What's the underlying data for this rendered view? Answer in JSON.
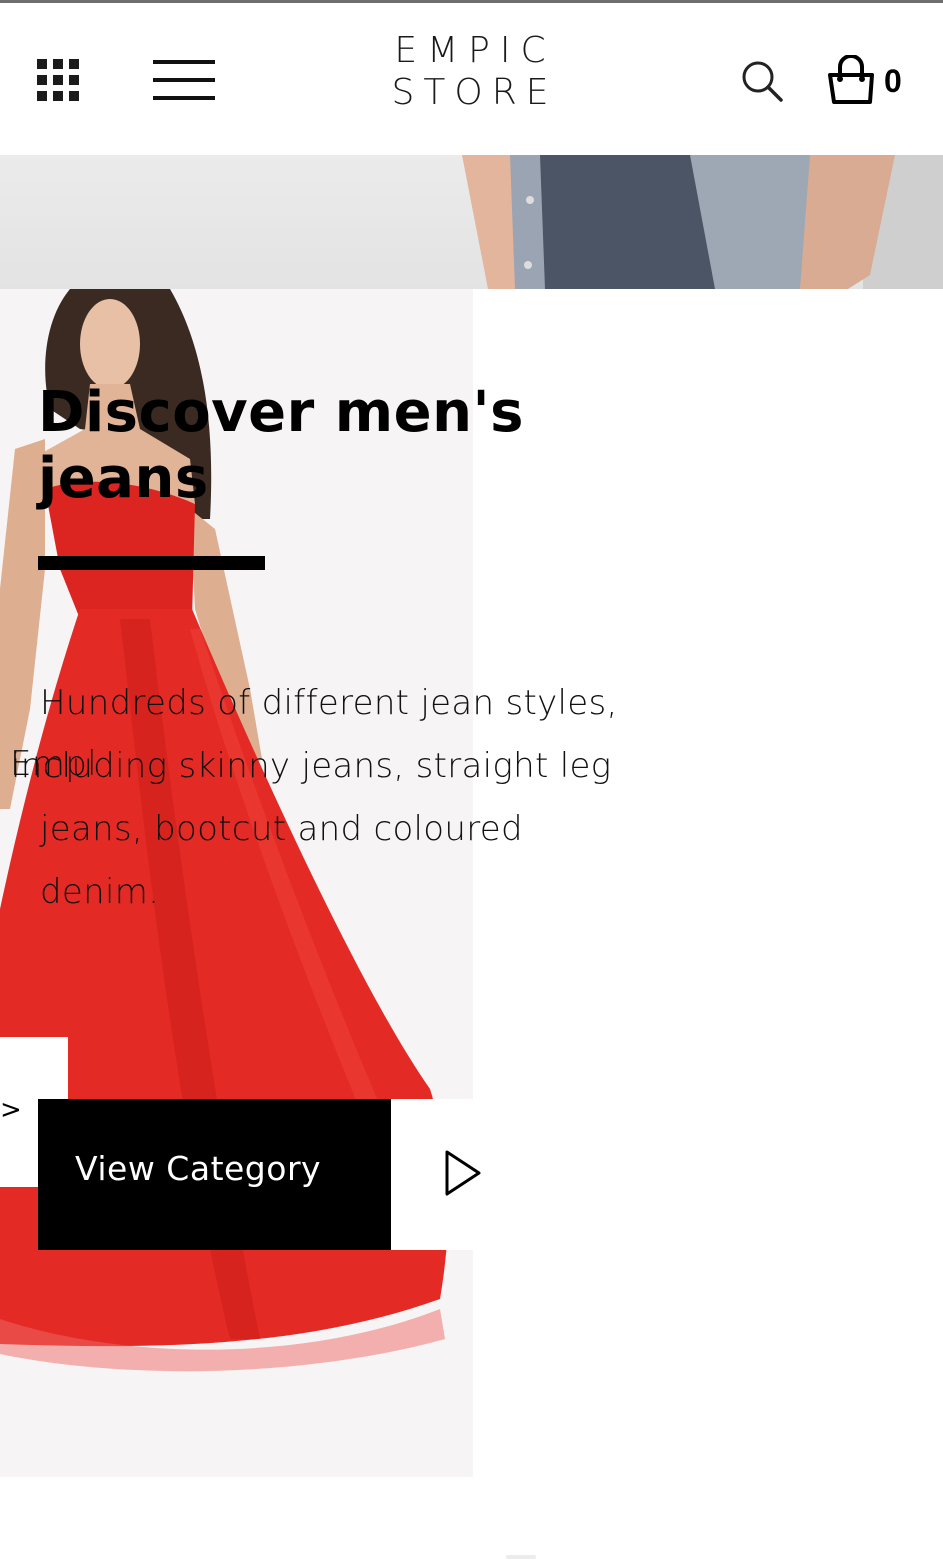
{
  "header": {
    "logo_line1": "EMPIC",
    "logo_line2": "STORE",
    "cart_count": "0",
    "icons": [
      "grid-icon",
      "menu-icon",
      "search-icon",
      "shopping-bag-icon"
    ]
  },
  "hero": {
    "headline_line1": "Discover men's",
    "headline_line2": "jeans",
    "description_line1": "Hundreds of different jean styles,",
    "description_line2": "including skinny jeans, straight leg",
    "description_line3": "jeans, bootcut and coloured",
    "description_line4": "denim.",
    "overlap_text": "Empl",
    "cta_label": "View Category",
    "prev_arrow": ">"
  },
  "colors": {
    "text": "#000000",
    "button_bg": "#000000",
    "button_text": "#ffffff",
    "dress_red": "#e0201c"
  }
}
